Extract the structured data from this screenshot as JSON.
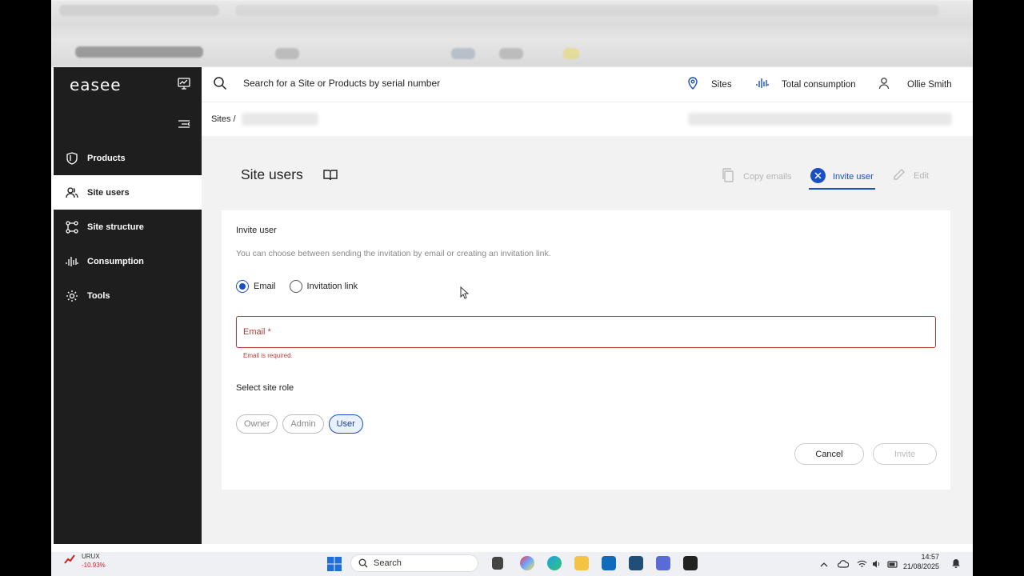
{
  "sidebar": {
    "logo": "easee",
    "items": [
      {
        "label": "Products",
        "icon": "shield-icon",
        "active": false
      },
      {
        "label": "Site users",
        "icon": "users-icon",
        "active": true
      },
      {
        "label": "Site structure",
        "icon": "structure-icon",
        "active": false
      },
      {
        "label": "Consumption",
        "icon": "waveform-icon",
        "active": false
      },
      {
        "label": "Tools",
        "icon": "gear-icon",
        "active": false
      }
    ]
  },
  "header": {
    "search_placeholder": "Search for a Site or Products by serial number",
    "sites_label": "Sites",
    "consumption_label": "Total consumption",
    "user_name": "Ollie Smith"
  },
  "breadcrumb": {
    "root": "Sites",
    "separator": "/"
  },
  "page": {
    "title": "Site users",
    "actions": {
      "copy_emails": "Copy emails",
      "invite_user": "Invite user",
      "edit": "Edit"
    }
  },
  "invite_form": {
    "title": "Invite user",
    "subtitle": "You can choose between sending the invitation by email or creating an invitation link.",
    "method_options": [
      {
        "label": "Email",
        "checked": true
      },
      {
        "label": "Invitation link",
        "checked": false
      }
    ],
    "email_label": "Email *",
    "email_value": "",
    "email_error": "Email is required.",
    "role_title": "Select site role",
    "roles": [
      {
        "label": "Owner",
        "selected": false
      },
      {
        "label": "Admin",
        "selected": false
      },
      {
        "label": "User",
        "selected": true
      }
    ],
    "cancel_label": "Cancel",
    "invite_label": "Invite"
  },
  "taskbar": {
    "ticker_symbol": "URUX",
    "ticker_change": "-10.93%",
    "search_label": "Search",
    "time": "14:57",
    "date": "21/08/2025"
  },
  "colors": {
    "accent": "#1a4fc4",
    "error": "#b73a3a",
    "sidebar_bg": "#1e1e1e",
    "main_bg": "#f2f2f2"
  }
}
